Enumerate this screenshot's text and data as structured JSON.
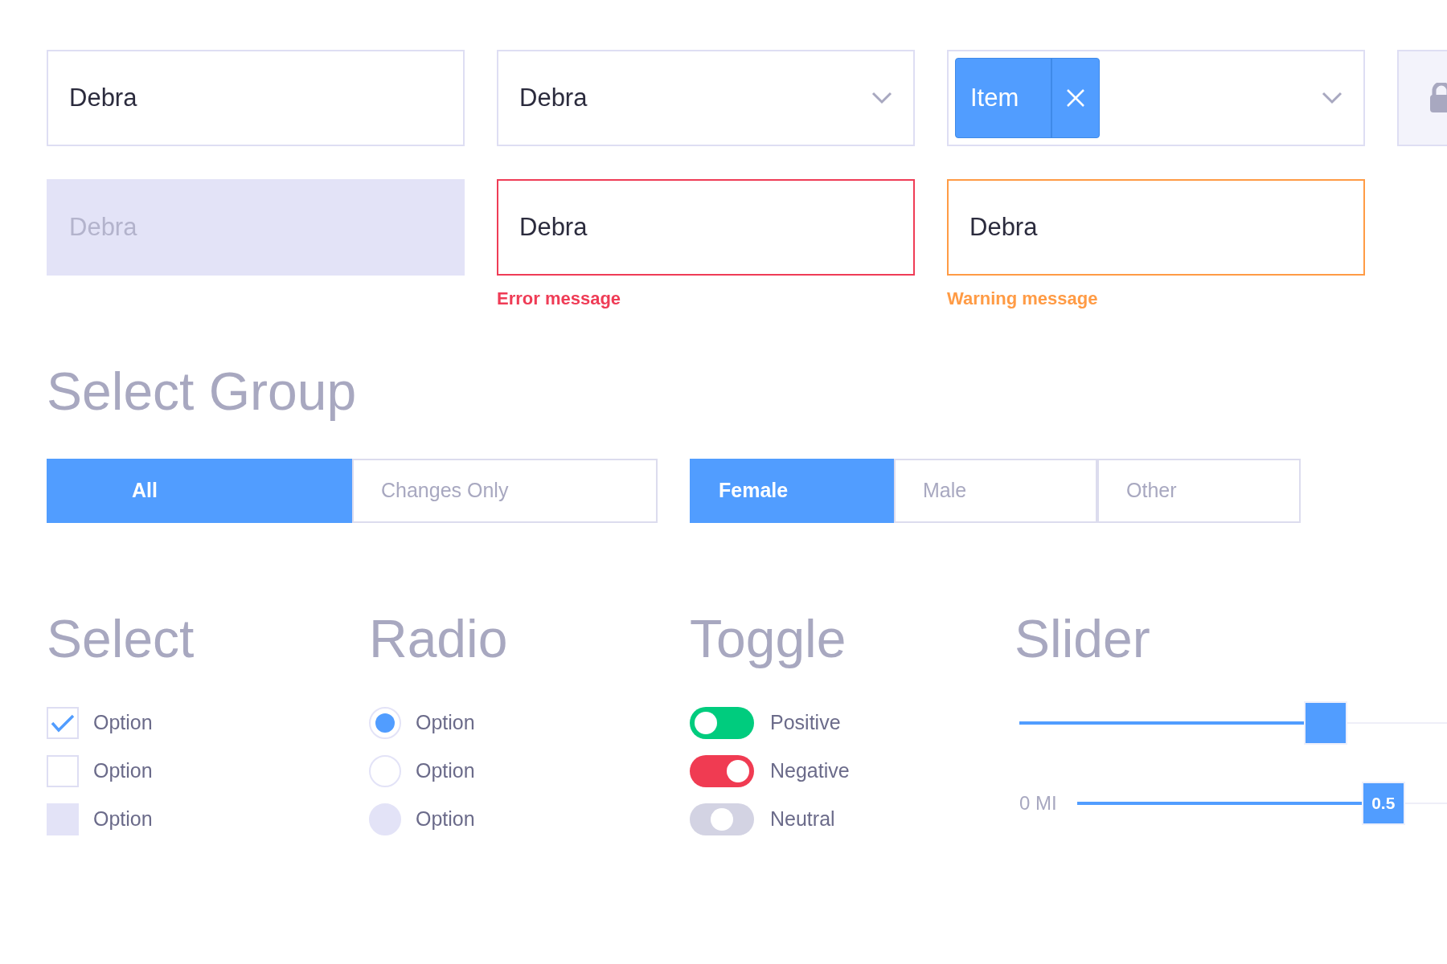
{
  "fields": [
    {
      "kind": "text",
      "value": "Debra"
    },
    {
      "kind": "dropdown",
      "value": "Debra"
    },
    {
      "kind": "tags",
      "tags": [
        "Item"
      ]
    },
    {
      "kind": "locked"
    },
    {
      "kind": "disabled",
      "value": "Debra"
    },
    {
      "kind": "error",
      "value": "Debra",
      "message": "Error message"
    },
    {
      "kind": "warning",
      "value": "Debra",
      "message": "Warning message"
    }
  ],
  "select_group": {
    "title": "Select Group",
    "groups": [
      [
        {
          "label": "All",
          "selected": true
        },
        {
          "label": "Changes Only",
          "selected": false
        }
      ],
      [
        {
          "label": "Female",
          "selected": true
        },
        {
          "label": "Male",
          "selected": false
        },
        {
          "label": "Other",
          "selected": false
        }
      ]
    ]
  },
  "select": {
    "title": "Select",
    "items": [
      {
        "label": "Option",
        "checked": true,
        "disabled": false
      },
      {
        "label": "Option",
        "checked": false,
        "disabled": false
      },
      {
        "label": "Option",
        "checked": false,
        "disabled": true
      }
    ]
  },
  "radio": {
    "title": "Radio",
    "items": [
      {
        "label": "Option",
        "selected": true,
        "disabled": false
      },
      {
        "label": "Option",
        "selected": false,
        "disabled": false
      },
      {
        "label": "Option",
        "selected": false,
        "disabled": true
      }
    ]
  },
  "toggle": {
    "title": "Toggle",
    "items": [
      {
        "label": "Positive",
        "kind": "positive",
        "on": false,
        "disabled": false
      },
      {
        "label": "Negative",
        "kind": "negative",
        "on": true,
        "disabled": false
      },
      {
        "label": "Neutral",
        "kind": "neutral",
        "disabled": true
      }
    ]
  },
  "slider": {
    "title": "Slider",
    "sliders": [
      {
        "level": 0.59
      },
      {
        "label": "0 MI",
        "level": 0.67,
        "reading": "0.5"
      }
    ]
  }
}
